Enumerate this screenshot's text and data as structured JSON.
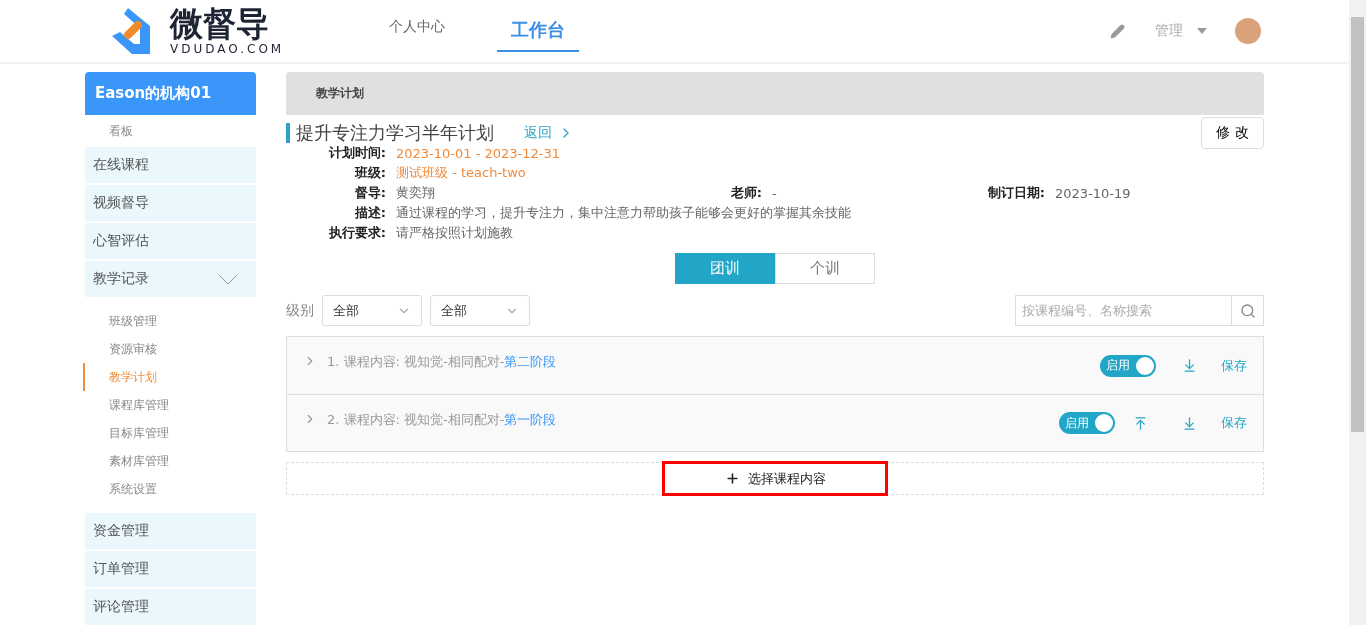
{
  "header": {
    "logo_name": "微督导",
    "logo_domain": "VDUDAO.COM",
    "nav": [
      {
        "label": "个人中心",
        "selected": false
      },
      {
        "label": "工作台",
        "selected": true
      }
    ],
    "admin_label": "管理"
  },
  "sidebar": {
    "org": "Eason的机构01",
    "dashboard": "看板",
    "items": [
      {
        "label": "在线课程"
      },
      {
        "label": "视频督导"
      },
      {
        "label": "心智评估"
      },
      {
        "label": "教学记录",
        "expanded": true,
        "children": [
          {
            "label": "班级管理",
            "selected": false
          },
          {
            "label": "资源审核",
            "selected": false
          },
          {
            "label": "教学计划",
            "selected": true
          },
          {
            "label": "课程库管理",
            "selected": false
          },
          {
            "label": "目标库管理",
            "selected": false
          },
          {
            "label": "素材库管理",
            "selected": false
          },
          {
            "label": "系统设置",
            "selected": false
          }
        ]
      },
      {
        "label": "资金管理"
      },
      {
        "label": "订单管理"
      },
      {
        "label": "评论管理"
      }
    ]
  },
  "breadcrumb": "教学计划",
  "plan": {
    "title": "提升专注力学习半年计划",
    "back": "返回",
    "edit_button": "修 改",
    "fields": [
      {
        "label": "计划时间:",
        "value": "2023-10-01 - 2023-12-31",
        "kind": "highlight"
      },
      {
        "label": "班级:",
        "value": "测试班级 - teach-two",
        "kind": "highlight"
      },
      {
        "label": "督导:",
        "value": "黄奕翔",
        "kind": "plain",
        "extra": [
          {
            "label": "老师:",
            "value": "-"
          },
          {
            "label": "制订日期:",
            "value": "2023-10-19"
          }
        ]
      },
      {
        "label": "描述:",
        "value": "通过课程的学习，提升专注力，集中注意力帮助孩子能够会更好的掌握其余技能",
        "kind": "plain"
      },
      {
        "label": "执行要求:",
        "value": "请严格按照计划施教",
        "kind": "plain"
      }
    ]
  },
  "mode_tabs": [
    {
      "label": "团训",
      "selected": true
    },
    {
      "label": "个训",
      "selected": false
    }
  ],
  "filter": {
    "label": "级别",
    "selects": [
      {
        "value": "全部"
      },
      {
        "value": "全部"
      }
    ],
    "search_placeholder": "按课程编号、名称搜索"
  },
  "courses": [
    {
      "number": "1.",
      "name": "课程内容: 视知觉-相同配对-",
      "stage": "第二阶段",
      "toggle_label": "启用",
      "on": true,
      "can_move_up": false,
      "save": "保存"
    },
    {
      "number": "2.",
      "name": "课程内容: 视知觉-相同配对-",
      "stage": "第一阶段",
      "toggle_label": "启用",
      "on": true,
      "can_move_up": true,
      "save": "保存"
    }
  ],
  "add_button": {
    "label": "选择课程内容",
    "highlighted": true
  }
}
